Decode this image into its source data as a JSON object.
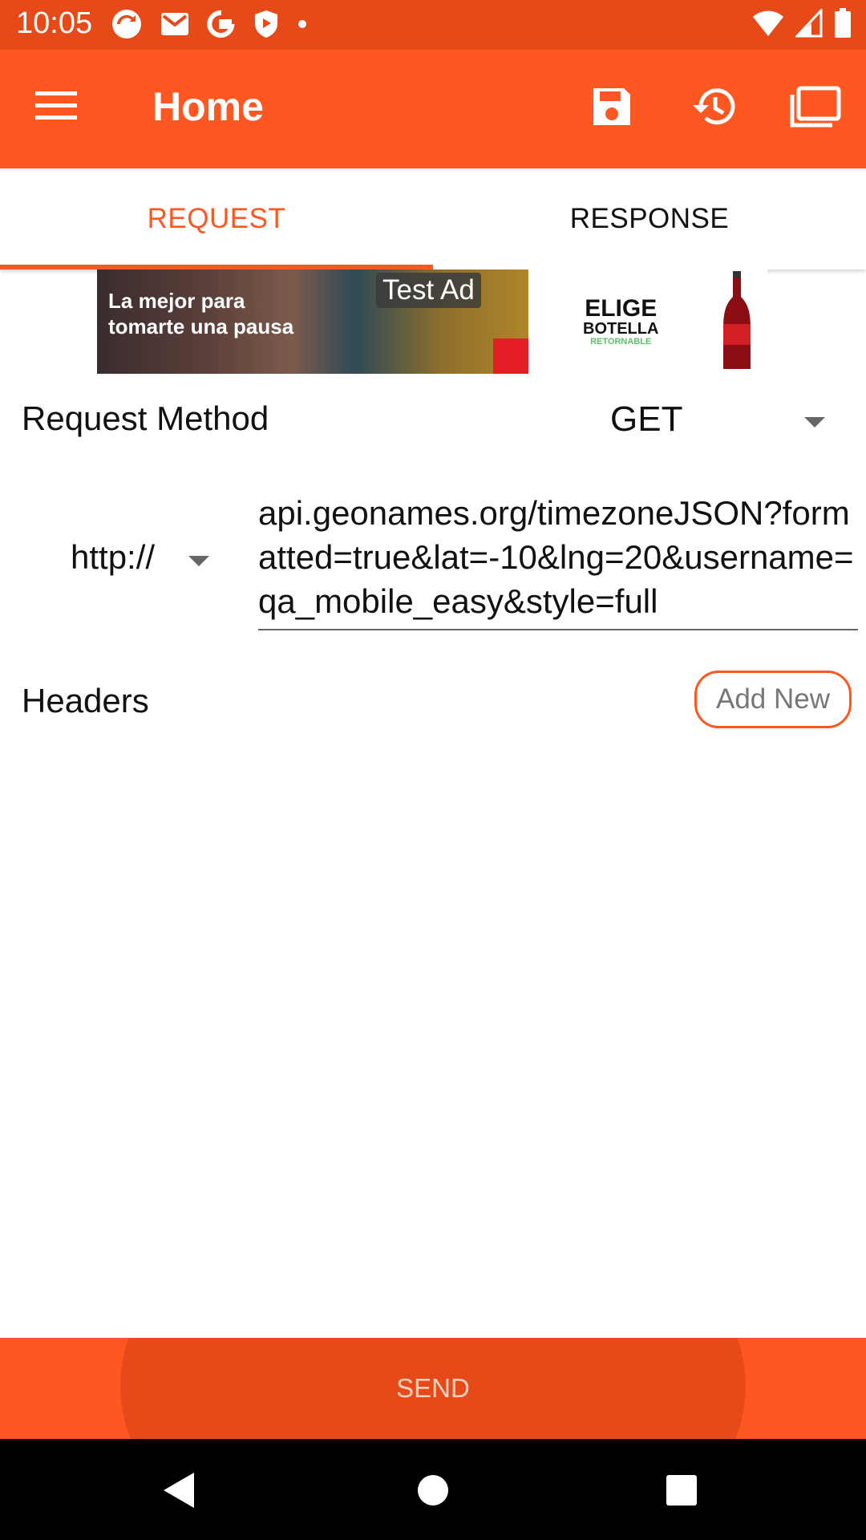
{
  "status_bar": {
    "time": "10:05",
    "icons_left": [
      "sync-icon",
      "gmail-icon",
      "google-icon",
      "shield-icon",
      "dot-icon"
    ],
    "icons_right": [
      "wifi-icon",
      "signal-icon",
      "battery-icon"
    ]
  },
  "app_bar": {
    "title": "Home",
    "actions": [
      "save-icon",
      "history-icon",
      "folders-icon"
    ]
  },
  "tabs": [
    {
      "label": "REQUEST",
      "active": true
    },
    {
      "label": "RESPONSE",
      "active": false
    }
  ],
  "ad": {
    "badge": "Test Ad",
    "line1": "La mejor para",
    "line2": "tomarte una pausa",
    "brand_line1": "ELIGE",
    "brand_line2": "BOTELLA",
    "brand_line3": "RETORNABLE"
  },
  "request": {
    "method_label": "Request Method",
    "method_value": "GET",
    "protocol_value": "http://",
    "url_value": "api.geonames.org/timezoneJSON?formatted=true&lat=-10&lng=20&username=qa_mobile_easy&style=full",
    "headers_label": "Headers",
    "add_new_label": "Add New"
  },
  "send_label": "SEND",
  "colors": {
    "primary": "#ff5722",
    "primary_dark": "#e64a19",
    "text": "#111111"
  }
}
